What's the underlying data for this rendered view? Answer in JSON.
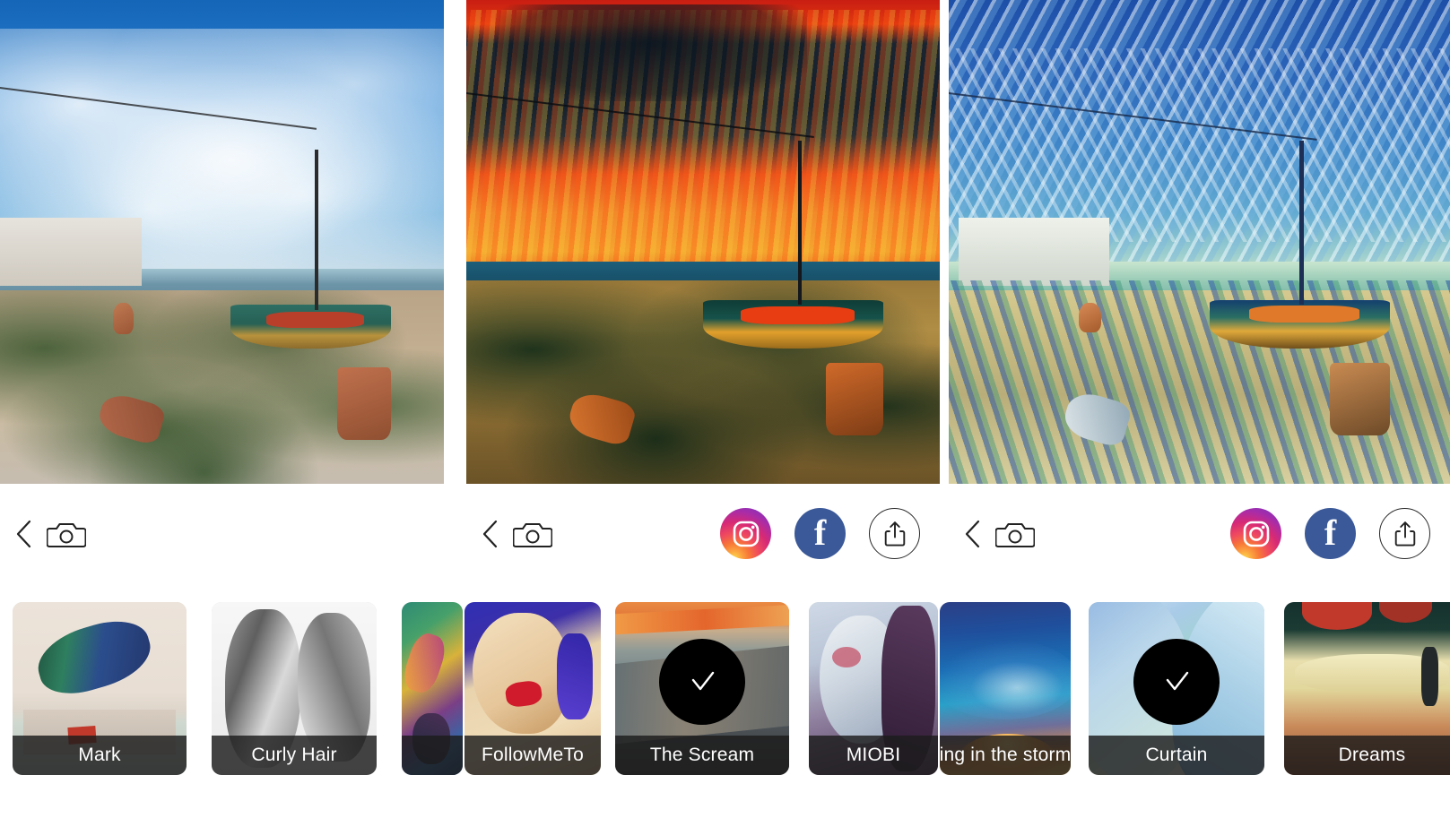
{
  "app": {
    "panel_count": 3
  },
  "panels": [
    {
      "id": "original",
      "photo_alt": "Seaside garden with fishing boat, clay pots and blue sky",
      "back_label": "Back",
      "camera_label": "Camera",
      "has_share_actions": false
    },
    {
      "id": "the-scream",
      "photo_alt": "Seaside garden restyled with The Scream fiery orange sky",
      "back_label": "Back",
      "camera_label": "Camera",
      "has_share_actions": true
    },
    {
      "id": "curtain",
      "photo_alt": "Seaside garden restyled with Curtain blue brushstroke style",
      "back_label": "Back",
      "camera_label": "Camera",
      "has_share_actions": true
    }
  ],
  "share": {
    "instagram_label": "Instagram",
    "facebook_label": "Facebook",
    "facebook_glyph": "f",
    "share_label": "Share",
    "instagram_icon": "instagram-icon",
    "facebook_icon": "facebook-icon",
    "share_icon": "share-icon",
    "back_icon": "chevron-left-icon",
    "camera_icon": "camera-icon",
    "colors": {
      "facebook_blue": "#3b5998",
      "instagram_pink": "#d62976",
      "instagram_orange": "#f77737",
      "instagram_yellow": "#fdd84a",
      "instagram_purple": "#6b35c9",
      "outline": "#2a2a2a"
    }
  },
  "styles_strip": {
    "selected_icon": "check-icon",
    "items": [
      {
        "name": "Mark",
        "selected": false,
        "clipped": false,
        "art": "bg-mark"
      },
      {
        "name": "Curly Hair",
        "selected": false,
        "clipped": false,
        "art": "bg-curly"
      },
      {
        "name": "",
        "selected": false,
        "clipped": true,
        "art": "bg-glass"
      },
      {
        "name": "FollowMeTo",
        "selected": false,
        "clipped": true,
        "art": "bg-pop"
      },
      {
        "name": "The Scream",
        "selected": true,
        "clipped": false,
        "art": "bg-scream"
      },
      {
        "name": "MIOBI",
        "selected": false,
        "clipped": true,
        "art": "bg-miobi"
      },
      {
        "name": "ing in the storm",
        "selected": false,
        "clipped": true,
        "art": "bg-storm"
      },
      {
        "name": "Curtain",
        "selected": true,
        "clipped": false,
        "art": "bg-curtain"
      },
      {
        "name": "Dreams",
        "selected": false,
        "clipped": true,
        "art": "bg-dreams"
      }
    ]
  }
}
